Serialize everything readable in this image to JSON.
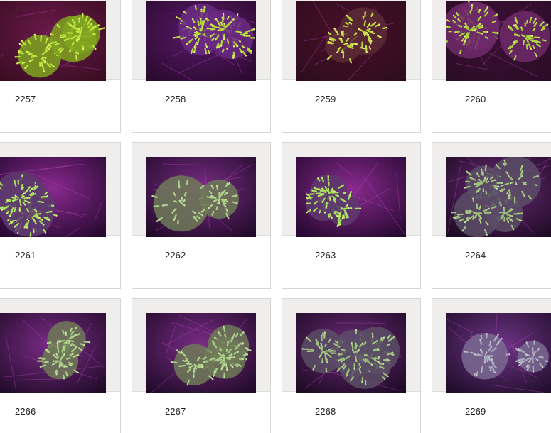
{
  "gallery": {
    "items": [
      {
        "label": "2257",
        "palette": "lime-bright"
      },
      {
        "label": "2258",
        "palette": "lime-purple"
      },
      {
        "label": "2259",
        "palette": "lime-dense"
      },
      {
        "label": "2260",
        "palette": "lime-small"
      },
      {
        "label": "2261",
        "palette": "green-ring"
      },
      {
        "label": "2262",
        "palette": "green-pale"
      },
      {
        "label": "2263",
        "palette": "green-ring"
      },
      {
        "label": "2264",
        "palette": "green-dim"
      },
      {
        "label": "2266",
        "palette": "green-pale"
      },
      {
        "label": "2267",
        "palette": "green-pale"
      },
      {
        "label": "2268",
        "palette": "green-dim"
      },
      {
        "label": "2269",
        "palette": "violet-pale"
      }
    ]
  },
  "colors": {
    "tank_bg": "#1a0f1e",
    "magenta_glow": "#8a2a8f",
    "lime": "#b6e23a",
    "green_ring": "#9edb55",
    "pale_green": "#a9c98a",
    "violet_pale": "#9e97b6"
  }
}
